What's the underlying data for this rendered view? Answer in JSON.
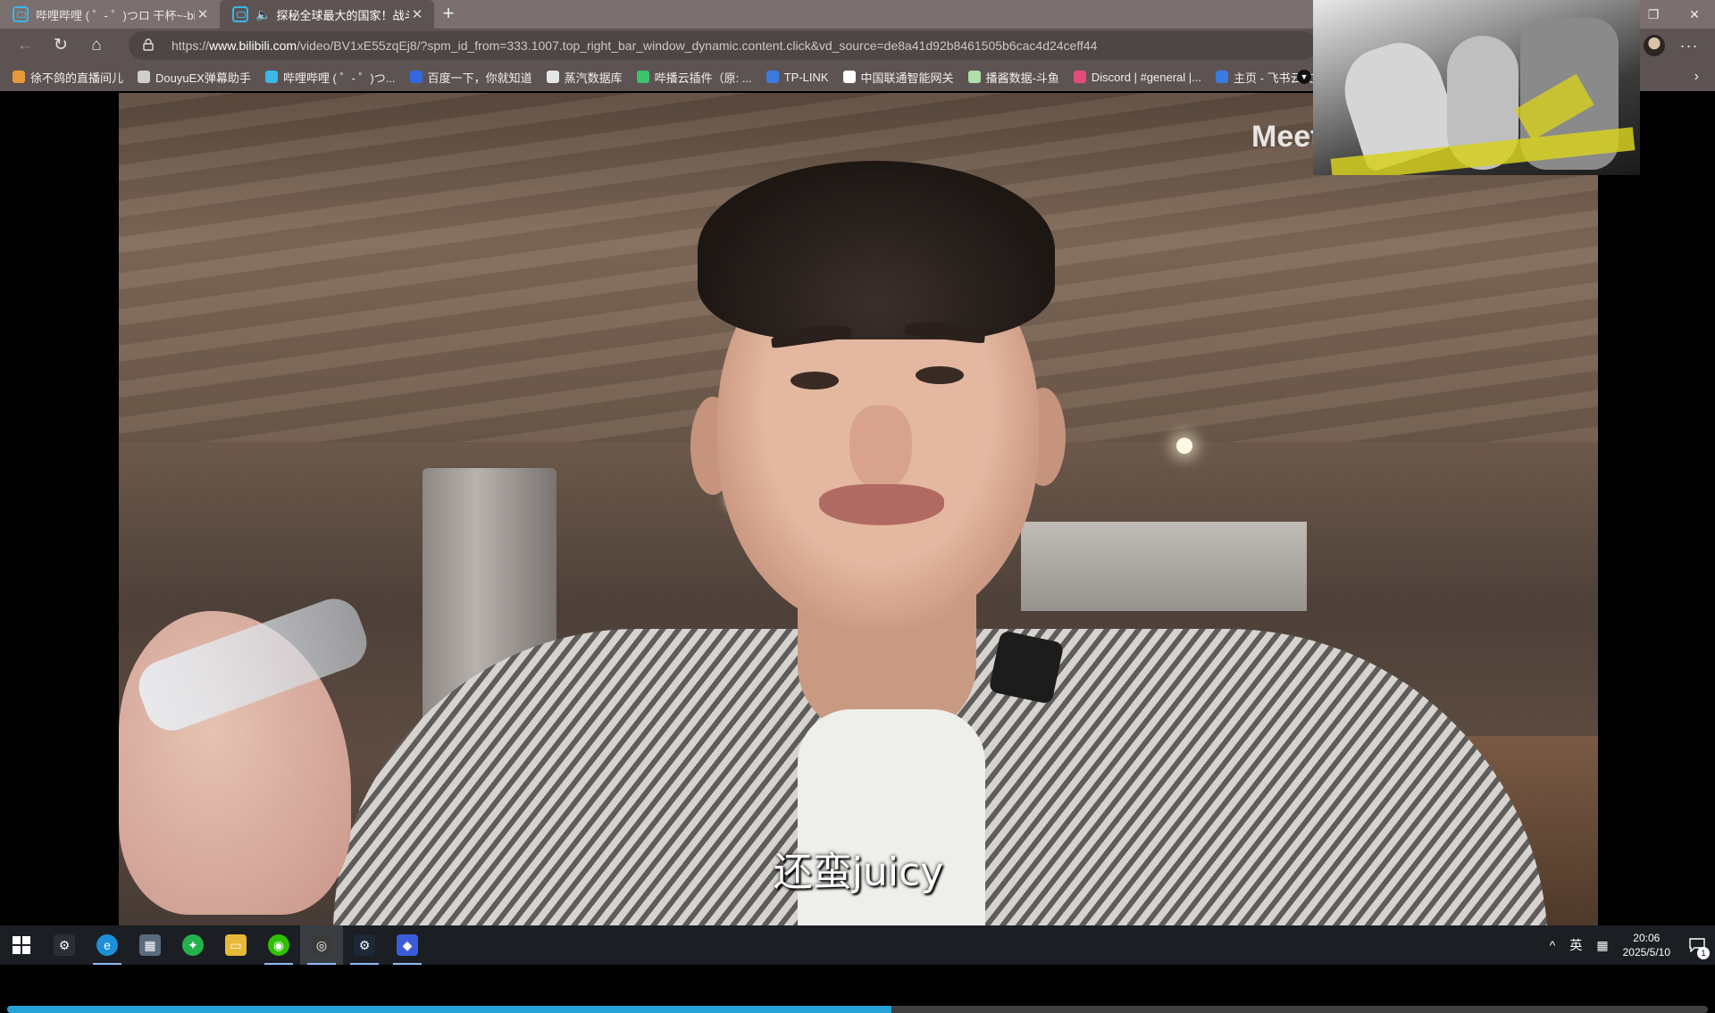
{
  "tabs": [
    {
      "title": "哔哩哔哩 ( ゜- ゜)つロ 干杯~-bilibili",
      "close": "✕",
      "active": false
    },
    {
      "title": "探秘全球最大的国家！战斗",
      "close": "✕",
      "active": true
    }
  ],
  "new_tab": "+",
  "window_controls": {
    "minimize": "—",
    "restore": "❐",
    "close": "✕"
  },
  "address": {
    "url_prefix": "https://",
    "url_host": "www.bilibili.com",
    "url_path": "/video/BV1xE55zqEj8/?spm_id_from=333.1007.top_right_bar_window_dynamic.content.click&vd_source=de8a41d92b8461505b6cac4d24ceff44"
  },
  "nav": {
    "back": "←",
    "reload": "↻",
    "home": "⌂",
    "lock": "🔒",
    "menu": "···"
  },
  "bookmarks": [
    {
      "label": "徐不鸽的直播间儿",
      "color": "#e89a3a"
    },
    {
      "label": "DouyuEX弹幕助手",
      "color": "#cfcfcf"
    },
    {
      "label": "哔哩哔哩 ( ゜- ゜)つ...",
      "color": "#39b7e8"
    },
    {
      "label": "百度一下，你就知道",
      "color": "#3468e0"
    },
    {
      "label": "蒸汽数据库",
      "color": "#e6e6e6"
    },
    {
      "label": "哔播云插件（原: ...",
      "color": "#3cc46b"
    },
    {
      "label": "TP-LINK",
      "color": "#3b7be0"
    },
    {
      "label": "中国联通智能网关",
      "color": "#ffffff"
    },
    {
      "label": "播酱数据-斗鱼",
      "color": "#aee0a8"
    },
    {
      "label": "Discord | #general |...",
      "color": "#e34d7a"
    },
    {
      "label": "主页 - 飞书云文档",
      "color": "#3b7be0"
    }
  ],
  "bookmarks_overflow": "▼",
  "bookmarks_chevron": "›",
  "video": {
    "watermark": "Meet",
    "subtitle": "还蛮juicy",
    "progress_fraction": 0.52
  },
  "taskbar": {
    "apps": [
      {
        "name": "start",
        "glyph": ""
      },
      {
        "name": "settings",
        "glyph": "⚙",
        "color": "#2b2f35"
      },
      {
        "name": "edge",
        "glyph": "e",
        "color": "#1d8fd8"
      },
      {
        "name": "calculator",
        "glyph": "▦",
        "color": "#5a6b7d"
      },
      {
        "name": "app-green",
        "glyph": "✦",
        "color": "#22b14c"
      },
      {
        "name": "file-explorer",
        "glyph": "▭",
        "color": "#e8b83a"
      },
      {
        "name": "wechat",
        "glyph": "◉",
        "color": "#2dc100"
      },
      {
        "name": "obs",
        "glyph": "◎",
        "color": "#3a3a3a"
      },
      {
        "name": "steam",
        "glyph": "⚙",
        "color": "#1b2838"
      },
      {
        "name": "app-blue",
        "glyph": "◆",
        "color": "#3a5bdc"
      }
    ],
    "tray": {
      "chevron": "^",
      "ime": "英",
      "ime_grid": "▦",
      "time": "20:06",
      "date": "2025/5/10",
      "notif_count": "1"
    }
  },
  "colors": {
    "accent": "#25a3d8",
    "chrome": "#5d5353",
    "tabstrip": "#7b6f6f"
  }
}
